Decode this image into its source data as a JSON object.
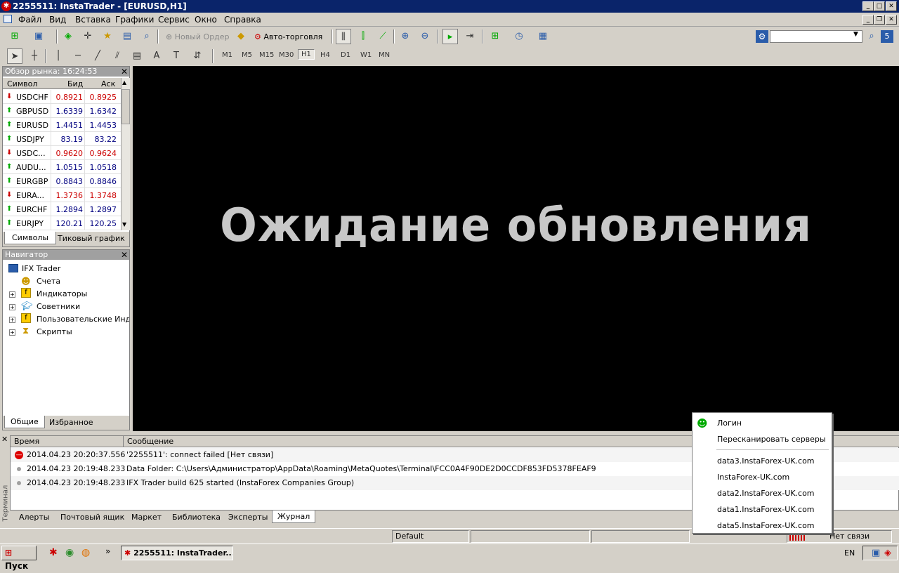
{
  "window": {
    "title": "2255511: InstaTrader - [EURUSD,H1]"
  },
  "menu": [
    "Файл",
    "Вид",
    "Вставка",
    "Графики",
    "Сервис",
    "Окно",
    "Справка"
  ],
  "toolbar": {
    "new_order": "Новый Ордер",
    "auto_trading": "Авто-торговля",
    "timeframes": [
      "M1",
      "M5",
      "M15",
      "M30",
      "H1",
      "H4",
      "D1",
      "W1",
      "MN"
    ],
    "active_timeframe": "H1"
  },
  "market_watch": {
    "title": "Обзор рынка: 16:24:53",
    "columns": [
      "Символ",
      "Бид",
      "Аск"
    ],
    "rows": [
      {
        "symbol": "USDCHF",
        "bid": "0.8921",
        "ask": "0.8925",
        "dir": "down"
      },
      {
        "symbol": "GBPUSD",
        "bid": "1.6339",
        "ask": "1.6342",
        "dir": "up"
      },
      {
        "symbol": "EURUSD",
        "bid": "1.4451",
        "ask": "1.4453",
        "dir": "up"
      },
      {
        "symbol": "USDJPY",
        "bid": "83.19",
        "ask": "83.22",
        "dir": "up"
      },
      {
        "symbol": "USDC...",
        "bid": "0.9620",
        "ask": "0.9624",
        "dir": "down"
      },
      {
        "symbol": "AUDU...",
        "bid": "1.0515",
        "ask": "1.0518",
        "dir": "up"
      },
      {
        "symbol": "EURGBP",
        "bid": "0.8843",
        "ask": "0.8846",
        "dir": "up"
      },
      {
        "symbol": "EURA...",
        "bid": "1.3736",
        "ask": "1.3748",
        "dir": "down"
      },
      {
        "symbol": "EURCHF",
        "bid": "1.2894",
        "ask": "1.2897",
        "dir": "up"
      },
      {
        "symbol": "EURJPY",
        "bid": "120.21",
        "ask": "120.25",
        "dir": "up"
      }
    ],
    "tabs": [
      "Символы",
      "Тиковый график"
    ]
  },
  "navigator": {
    "title": "Навигатор",
    "root": "IFX Trader",
    "items": [
      "Счета",
      "Индикаторы",
      "Советники",
      "Пользовательские Индик",
      "Скрипты"
    ],
    "tabs": [
      "Общие",
      "Избранное"
    ]
  },
  "chart": {
    "waiting_text": "Ожидание обновления"
  },
  "terminal": {
    "side_label": "Терминал",
    "columns": [
      "Время",
      "Сообщение"
    ],
    "rows": [
      {
        "time": "2014.04.23 20:20:37.556",
        "message": "'2255511': connect failed [Нет связи]",
        "level": "error"
      },
      {
        "time": "2014.04.23 20:19:48.233",
        "message": "Data Folder: C:\\Users\\Администратор\\AppData\\Roaming\\MetaQuotes\\Terminal\\FCC0A4F90DE2D0CCDF853FD5378FEAF9",
        "level": "info"
      },
      {
        "time": "2014.04.23 20:19:48.233",
        "message": "IFX Trader build 625 started (InstaForex Companies Group)",
        "level": "info"
      }
    ],
    "tabs": [
      "Алерты",
      "Почтовый ящик",
      "Маркет",
      "Библиотека",
      "Эксперты",
      "Журнал"
    ],
    "active_tab": "Журнал"
  },
  "context_menu": {
    "login": "Логин",
    "rescan": "Пересканировать серверы",
    "servers": [
      "data3.InstaForex-UK.com",
      "InstaForex-UK.com",
      "data2.InstaForex-UK.com",
      "data1.InstaForex-UK.com",
      "data5.InstaForex-UK.com"
    ]
  },
  "statusbar": {
    "profile": "Default",
    "connection": "Нет связи"
  },
  "taskbar": {
    "start": "Пуск",
    "task": "2255511: InstaTrader...",
    "lang": "EN"
  }
}
